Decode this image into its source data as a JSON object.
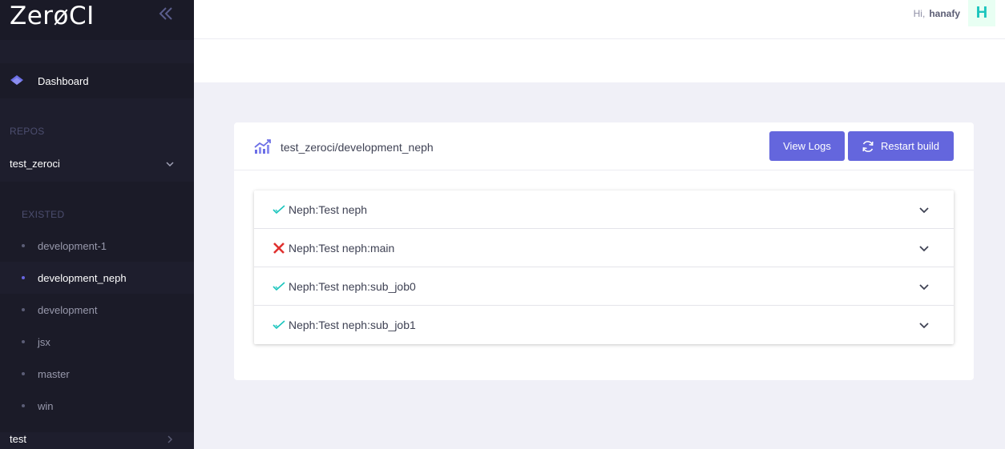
{
  "app": {
    "logo_text": "ZerøCI"
  },
  "sidebar": {
    "dashboard_label": "Dashboard",
    "repos_section": "REPOS",
    "repos": [
      {
        "label": "test_zeroci",
        "expanded": true
      },
      {
        "label": "test",
        "expanded": false
      }
    ],
    "existed_section": "EXISTED",
    "branches": [
      {
        "label": "development-1",
        "active": false
      },
      {
        "label": "development_neph",
        "active": true
      },
      {
        "label": "development",
        "active": false
      },
      {
        "label": "jsx",
        "active": false
      },
      {
        "label": "master",
        "active": false
      },
      {
        "label": "win",
        "active": false
      }
    ]
  },
  "topbar": {
    "greeting": "Hi,",
    "username": "hanafy",
    "avatar_letter": "H"
  },
  "build": {
    "title": "test_zeroci/development_neph",
    "view_logs_label": "View Logs",
    "restart_label": "Restart build",
    "jobs": [
      {
        "name": "Neph:Test neph",
        "status": "success"
      },
      {
        "name": "Neph:Test neph:main",
        "status": "failure"
      },
      {
        "name": "Neph:Test neph:sub_job0",
        "status": "success"
      },
      {
        "name": "Neph:Test neph:sub_job1",
        "status": "success"
      }
    ]
  },
  "colors": {
    "accent": "#6466dd",
    "sidebar_bg": "#1e1e2d",
    "success": "#1bc5bd",
    "failure": "#e0312f"
  }
}
